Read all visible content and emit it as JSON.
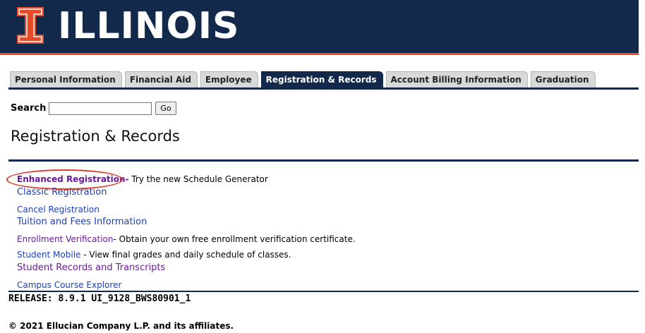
{
  "header": {
    "logo_text": "ILLINOIS",
    "colors": {
      "navy": "#13294b",
      "orange": "#e84a27"
    }
  },
  "tabs": [
    {
      "label": "Personal Information",
      "active": false
    },
    {
      "label": "Financial Aid",
      "active": false
    },
    {
      "label": "Employee",
      "active": false
    },
    {
      "label": "Registration & Records",
      "active": true
    },
    {
      "label": "Account Billing Information",
      "active": false
    },
    {
      "label": "Graduation",
      "active": false
    }
  ],
  "search": {
    "label": "Search",
    "value": "",
    "button_label": "Go"
  },
  "page_title": "Registration & Records",
  "menu": [
    {
      "link": "Enhanced Registration-",
      "desc": " Try the new Schedule Generator",
      "color": "purple",
      "highlighted": true
    },
    {
      "link": "Classic Registration",
      "desc": "",
      "color": "blue"
    },
    {
      "link": "Cancel Registration",
      "desc": "",
      "color": "blue"
    },
    {
      "link": "Tuition and Fees Information",
      "desc": "",
      "color": "blue"
    },
    {
      "link": "Enrollment Verification",
      "desc": "- Obtain your own free enrollment verification certificate.",
      "color": "purple"
    },
    {
      "link": "Student Mobile",
      "desc": " - View final grades and daily schedule of classes.",
      "color": "blue"
    },
    {
      "link": "Student Records and Transcripts",
      "desc": "",
      "color": "purple"
    },
    {
      "link": "Campus Course Explorer",
      "desc": "",
      "color": "blue"
    }
  ],
  "release": "RELEASE: 8.9.1 UI_9128_BWS80901_1",
  "copyright": "© 2021 Ellucian Company L.P. and its affiliates."
}
